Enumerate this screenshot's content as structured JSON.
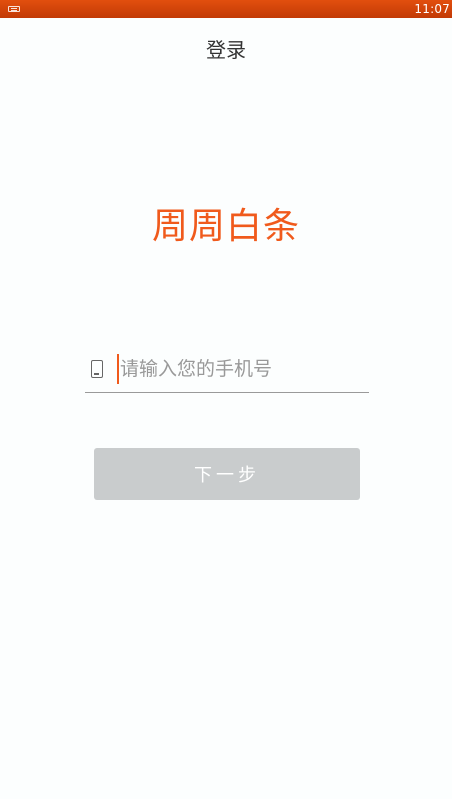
{
  "status_bar": {
    "time": "11:07",
    "left_icon": "keyboard-icon"
  },
  "header": {
    "title": "登录"
  },
  "logo": {
    "text": "周周白条",
    "color": "#f05a1c"
  },
  "form": {
    "phone_icon": "phone-icon",
    "phone_placeholder": "请输入您的手机号",
    "phone_value": ""
  },
  "next_button": {
    "label": "下一步",
    "background": "#c9cccd"
  },
  "colors": {
    "status_bar": "#d4460a",
    "accent": "#f05a1c"
  }
}
